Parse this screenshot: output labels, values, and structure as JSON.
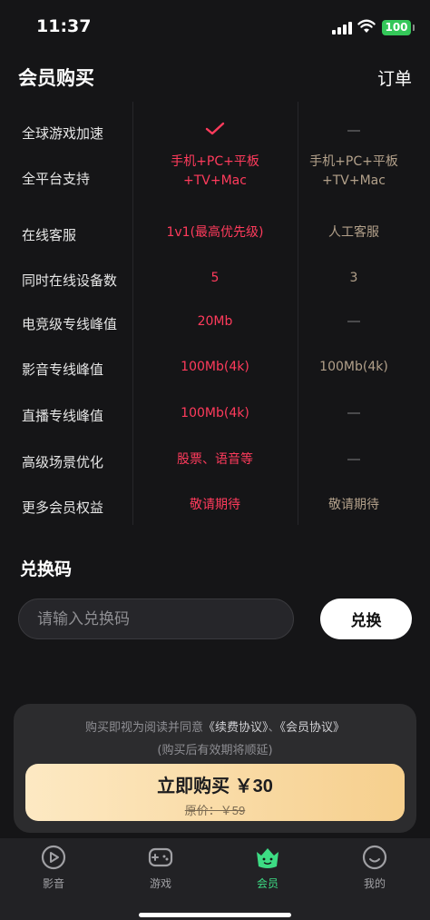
{
  "status_bar": {
    "time": "11:37",
    "battery": "100"
  },
  "nav": {
    "title": "会员购买",
    "action": "订单"
  },
  "benefits": [
    {
      "label": "全球游戏加速",
      "pro": {
        "type": "check"
      },
      "basic": {
        "type": "dash"
      }
    },
    {
      "label": "全平台支持",
      "pro": {
        "type": "text",
        "lines": [
          "手机+PC+平板",
          "+TV+Mac"
        ]
      },
      "basic": {
        "type": "text",
        "lines": [
          "手机+PC+平板",
          "+TV+Mac"
        ]
      }
    },
    {
      "label": "在线客服",
      "pro": {
        "type": "text",
        "lines": [
          "1v1(最高优先级)"
        ]
      },
      "basic": {
        "type": "text",
        "lines": [
          "人工客服"
        ]
      }
    },
    {
      "label": "同时在线设备数",
      "pro": {
        "type": "text",
        "lines": [
          "5"
        ]
      },
      "basic": {
        "type": "text",
        "lines": [
          "3"
        ]
      }
    },
    {
      "label": "电竞级专线峰值",
      "pro": {
        "type": "text",
        "lines": [
          "20Mb"
        ]
      },
      "basic": {
        "type": "dash"
      }
    },
    {
      "label": "影音专线峰值",
      "pro": {
        "type": "text",
        "lines": [
          "100Mb(4k)"
        ]
      },
      "basic": {
        "type": "text",
        "lines": [
          "100Mb(4k)"
        ]
      }
    },
    {
      "label": "直播专线峰值",
      "pro": {
        "type": "text",
        "lines": [
          "100Mb(4k)"
        ]
      },
      "basic": {
        "type": "dash"
      }
    },
    {
      "label": "高级场景优化",
      "pro": {
        "type": "text",
        "lines": [
          "股票、语音等"
        ]
      },
      "basic": {
        "type": "dash"
      }
    },
    {
      "label": "更多会员权益",
      "pro": {
        "type": "text",
        "lines": [
          "敬请期待"
        ]
      },
      "basic": {
        "type": "text",
        "lines": [
          "敬请期待"
        ]
      }
    }
  ],
  "redeem": {
    "title": "兑换码",
    "placeholder": "请输入兑换码",
    "button": "兑换"
  },
  "purchase": {
    "agreement_prefix": "购买即视为阅读并同意",
    "agreement_link_1": "《续费协议》",
    "agreement_sep": "、",
    "agreement_link_2": "《会员协议》",
    "renew_note": "(购买后有效期将顺延)",
    "button_label": "立即购买 ￥30",
    "original_price": "原价：￥59"
  },
  "tabs": [
    {
      "label": "影音",
      "icon": "play-circle-icon",
      "active": false
    },
    {
      "label": "游戏",
      "icon": "gamepad-icon",
      "active": false
    },
    {
      "label": "会员",
      "icon": "crown-icon",
      "active": true
    },
    {
      "label": "我的",
      "icon": "smile-face-icon",
      "active": false
    }
  ],
  "colors": {
    "accent_pink": "#ff3b5c",
    "basic_gold": "#b2a08a",
    "tab_active": "#3ddc84",
    "buy_gradient": [
      "#fde9c3",
      "#f6cf8d"
    ]
  }
}
